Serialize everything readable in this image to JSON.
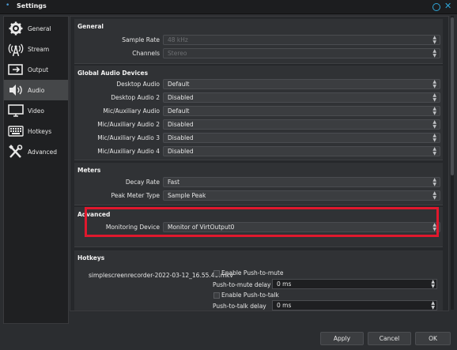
{
  "window": {
    "title": "Settings"
  },
  "sidebar": {
    "items": [
      {
        "label": "General",
        "icon": "gear-icon"
      },
      {
        "label": "Stream",
        "icon": "broadcast-antenna-icon"
      },
      {
        "label": "Output",
        "icon": "output-icon"
      },
      {
        "label": "Audio",
        "icon": "speaker-icon",
        "active": true
      },
      {
        "label": "Video",
        "icon": "monitor-icon"
      },
      {
        "label": "Hotkeys",
        "icon": "keyboard-icon"
      },
      {
        "label": "Advanced",
        "icon": "tools-icon"
      }
    ]
  },
  "general": {
    "title": "General",
    "sample_rate_label": "Sample Rate",
    "sample_rate_value": "48 kHz",
    "channels_label": "Channels",
    "channels_value": "Stereo"
  },
  "global_audio": {
    "title": "Global Audio Devices",
    "rows": [
      {
        "label": "Desktop Audio",
        "value": "Default"
      },
      {
        "label": "Desktop Audio 2",
        "value": "Disabled"
      },
      {
        "label": "Mic/Auxiliary Audio",
        "value": "Default"
      },
      {
        "label": "Mic/Auxiliary Audio 2",
        "value": "Disabled"
      },
      {
        "label": "Mic/Auxiliary Audio 3",
        "value": "Disabled"
      },
      {
        "label": "Mic/Auxiliary Audio 4",
        "value": "Disabled"
      }
    ]
  },
  "meters": {
    "title": "Meters",
    "decay_rate_label": "Decay Rate",
    "decay_rate_value": "Fast",
    "peak_meter_label": "Peak Meter Type",
    "peak_meter_value": "Sample Peak"
  },
  "advanced": {
    "title": "Advanced",
    "monitoring_label": "Monitoring Device",
    "monitoring_value": "Monitor of VirtOutput0"
  },
  "hotkeys": {
    "title": "Hotkeys",
    "source_name": "simplescreenrecorder-2022-03-12_16.55.40.mkv",
    "enable_ptm": "Enable Push-to-mute",
    "ptm_delay_label": "Push-to-mute delay",
    "ptm_delay_value": "0 ms",
    "enable_ptt": "Enable Push-to-talk",
    "ptt_delay_label": "Push-to-talk delay",
    "ptt_delay_value": "0 ms"
  },
  "buttons": {
    "apply": "Apply",
    "cancel": "Cancel",
    "ok": "OK"
  },
  "colors": {
    "highlight": "#e0182d",
    "accent": "#2fa6d8"
  }
}
